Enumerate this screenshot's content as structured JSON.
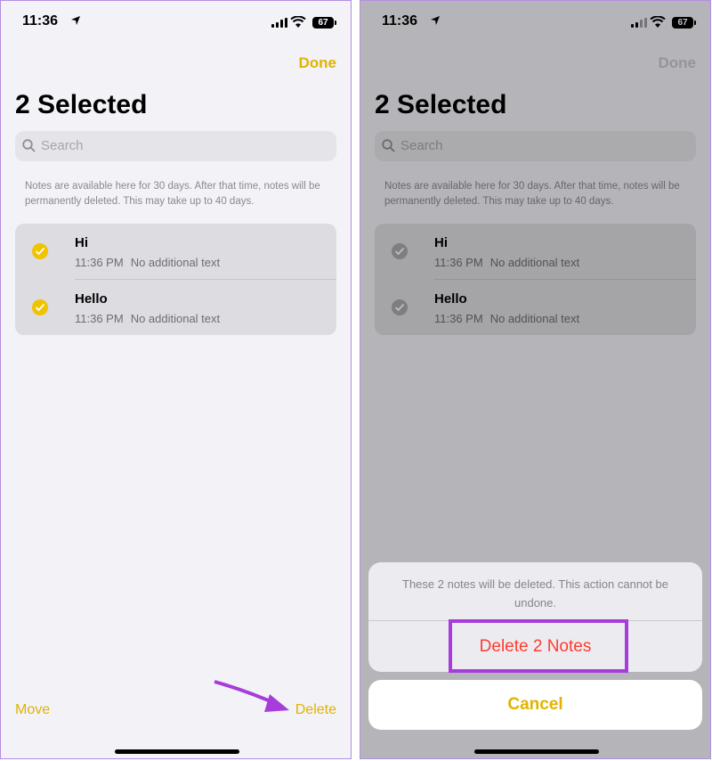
{
  "status": {
    "time": "11:36",
    "battery": "67"
  },
  "header": {
    "done_label": "Done",
    "title": "2 Selected"
  },
  "search": {
    "placeholder": "Search"
  },
  "info_text": "Notes are available here for 30 days. After that time, notes will be permanently deleted. This may take up to 40 days.",
  "notes": [
    {
      "title": "Hi",
      "time": "11:36 PM",
      "preview": "No additional text",
      "selected": true
    },
    {
      "title": "Hello",
      "time": "11:36 PM",
      "preview": "No additional text",
      "selected": true
    }
  ],
  "toolbar": {
    "move_label": "Move",
    "delete_label": "Delete"
  },
  "action_sheet": {
    "message": "These 2 notes will be deleted. This action cannot be undone.",
    "delete_label": "Delete 2 Notes",
    "cancel_label": "Cancel"
  },
  "colors": {
    "accent": "#e2b300",
    "destructive": "#ff3b30",
    "annotation": "#a63ddb"
  }
}
